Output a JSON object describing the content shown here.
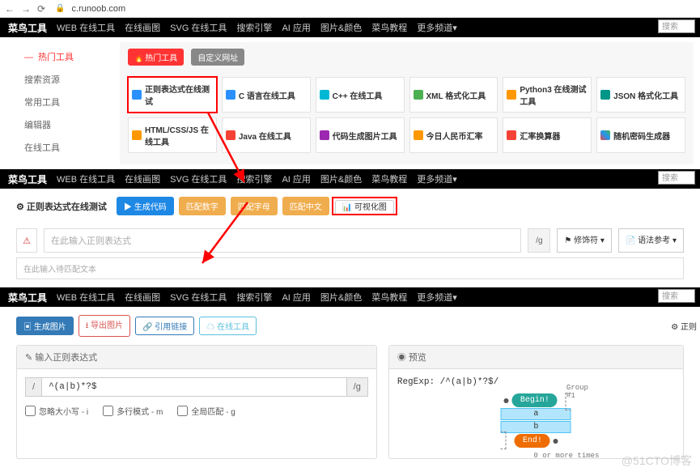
{
  "browser": {
    "url": "c.runoob.com"
  },
  "nav": {
    "brand": "菜鸟工具",
    "items": [
      "WEB 在线工具",
      "在线画图",
      "SVG 在线工具",
      "搜索引擎",
      "AI 应用",
      "图片&颜色",
      "菜鸟教程",
      "更多频道▾"
    ],
    "search_ph": "搜索"
  },
  "sidebar": {
    "items": [
      "热门工具",
      "搜索资源",
      "常用工具",
      "编辑器",
      "在线工具"
    ]
  },
  "tags": {
    "hot": "热门工具",
    "custom": "自定义网址"
  },
  "tools": {
    "r1": [
      "正则表达式在线测试",
      "C 语言在线工具",
      "C++ 在线工具",
      "XML 格式化工具",
      "Python3 在线测试工具",
      "JSON 格式化工具"
    ],
    "r2": [
      "HTML/CSS/JS 在线工具",
      "Java 在线工具",
      "代码生成图片工具",
      "今日人民币汇率",
      "汇率换算器",
      "随机密码生成器"
    ]
  },
  "sec2": {
    "title": "正则表达式在线测试",
    "btn_gen": "▶ 生成代码",
    "btn_num": "匹配数字",
    "btn_alpha": "匹配字母",
    "btn_cn": "匹配中文",
    "btn_vis": "📊 可视化图",
    "regex_ph": "在此输入正则表达式",
    "g": "/g",
    "btn_mod": "修饰符 ▾",
    "btn_ref": "语法参考 ▾",
    "match_ph": "在此输入待匹配文本"
  },
  "sec3": {
    "btns": [
      "生成图片",
      "导出图片",
      "引用链接",
      "在线工具"
    ],
    "right_label": "正则",
    "panel_left": "输入正则表达式",
    "panel_right": "预览",
    "slash": "/",
    "regex_value": "^(a|b)*?$",
    "g": "/g",
    "chk": [
      "忽略大小写 - i",
      "多行模式 - m",
      "全局匹配 - g"
    ],
    "diagram": {
      "expr": "RegExp: /^(a|b)*?$/",
      "begin": "Begin!",
      "end": "End!",
      "group": "Group #1",
      "loop": "0 or more times",
      "a": "a",
      "b": "b"
    }
  },
  "watermark": "@51CTO博客"
}
